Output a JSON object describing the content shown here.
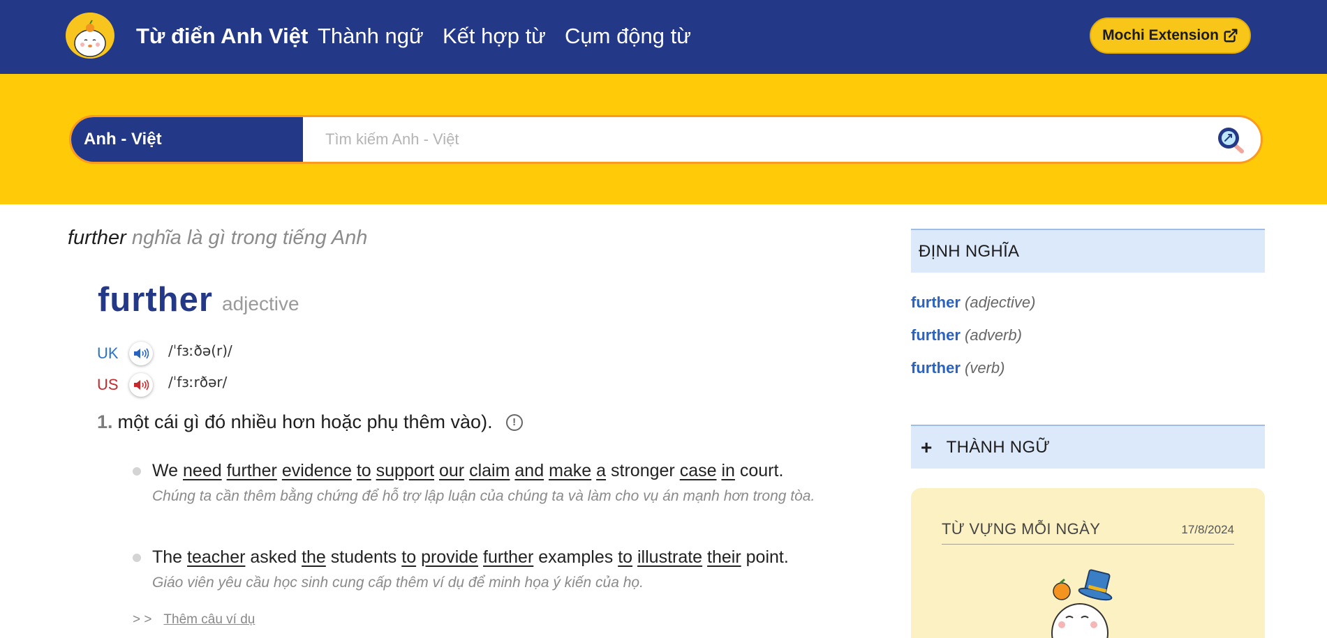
{
  "header": {
    "nav": {
      "home": "Từ điển Anh Việt",
      "idioms": "Thành ngữ",
      "collocations": "Kết hợp từ",
      "phrasal_verbs": "Cụm động từ"
    },
    "extension_button": "Mochi Extension"
  },
  "search": {
    "language_toggle": "Anh - Việt",
    "placeholder": "Tìm kiếm Anh - Việt",
    "value": ""
  },
  "entry": {
    "question_word": "further",
    "question_rest": " nghĩa là gì trong tiếng Anh",
    "headword": "further",
    "part_of_speech": "adjective",
    "pronunciations": [
      {
        "label": "UK",
        "ipa": "/ˈfɜːðə(r)/"
      },
      {
        "label": "US",
        "ipa": "/ˈfɜːrðər/"
      }
    ],
    "sense": {
      "number": "1.",
      "definition": "một cái gì đó nhiều hơn hoặc phụ thêm vào).",
      "info_icon": "!"
    },
    "examples": [
      {
        "en_words": [
          "We",
          "need",
          "further",
          "evidence",
          "to",
          "support",
          "our",
          "claim",
          "and",
          "make",
          "a",
          "stronger",
          "case",
          "in",
          "court."
        ],
        "en_underlined": [
          false,
          true,
          true,
          true,
          true,
          true,
          true,
          true,
          true,
          true,
          true,
          false,
          true,
          true,
          false
        ],
        "vi": "Chúng ta cần thêm bằng chứng để hỗ trợ lập luận của chúng ta và làm cho vụ án mạnh hơn trong tòa."
      },
      {
        "en_words": [
          "The",
          "teacher",
          "asked",
          "the",
          "students",
          "to",
          "provide",
          "further",
          "examples",
          "to",
          "illustrate",
          "their",
          "point."
        ],
        "en_underlined": [
          false,
          true,
          false,
          true,
          false,
          true,
          true,
          true,
          false,
          true,
          true,
          true,
          false
        ],
        "vi": "Giáo viên yêu cầu học sinh cung cấp thêm ví dụ để minh họa ý kiến của họ."
      }
    ],
    "more_arrows": "> >",
    "more_examples": "Thêm câu ví dụ"
  },
  "sidebar": {
    "definitions_title": "ĐỊNH NGHĨA",
    "definitions": [
      {
        "word": "further",
        "pos": "(adjective)"
      },
      {
        "word": "further",
        "pos": "(adverb)"
      },
      {
        "word": "further",
        "pos": "(verb)"
      }
    ],
    "idioms_plus": "+",
    "idioms_title": "THÀNH NGỮ",
    "word_of_day": {
      "title": "TỪ VỰNG MỖI NGÀY",
      "date": "17/8/2024"
    }
  },
  "colors": {
    "nav_bg": "#233886",
    "search_band": "#ffcb09",
    "search_border": "#fb9a1e",
    "accent_button": "#f8c618",
    "uk_blue": "#2a73c9",
    "us_red": "#c8282c",
    "link_blue": "#2a62c0",
    "panel_head_bg": "#dce9fb",
    "wotd_bg": "#fcf1c3"
  },
  "icons": {
    "logo": "mochi-mascot-logo",
    "extension": "external-link-icon",
    "search": "magnifier-icon",
    "speaker_uk": "speaker-icon",
    "speaker_us": "speaker-icon",
    "info": "info-icon",
    "wotd_mascot": "mascot-with-top-hat"
  }
}
